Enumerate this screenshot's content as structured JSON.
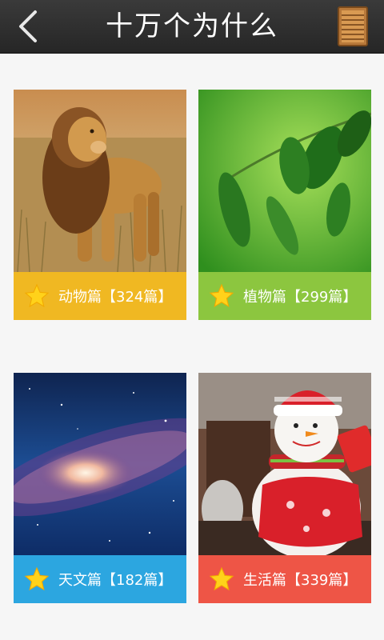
{
  "header": {
    "title": "十万个为什么",
    "back_icon": "chevron-left-icon",
    "menu_icon": "bookshelf-icon"
  },
  "categories": [
    {
      "label": "动物篇【324篇】",
      "color": "#f0b822",
      "image": "lion-photo"
    },
    {
      "label": "植物篇【299篇】",
      "color": "#8cc63f",
      "image": "leaves-photo"
    },
    {
      "label": "天文篇【182篇】",
      "color": "#2ca6e0",
      "image": "galaxy-photo"
    },
    {
      "label": "生活篇【339篇】",
      "color": "#ee5546",
      "image": "snowman-photo"
    }
  ],
  "colors": {
    "header_bg": "#2d2d2d",
    "page_bg": "#f6f6f6",
    "star": "#ffd21a"
  }
}
